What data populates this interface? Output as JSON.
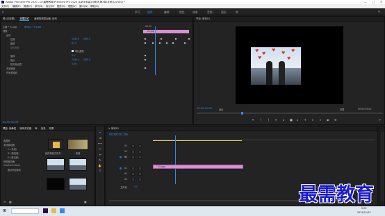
{
  "window": {
    "title": "Adobe Premiere Pro 2020 - D:\\最需教育\\Premiere Pro 2020 从新手到高手\\素材\\第3章\\未命名.prproj *"
  },
  "menu": [
    "文件(F)",
    "编辑(E)",
    "剪辑(C)",
    "序列(S)",
    "标记(M)",
    "图形(G)",
    "视图(V)",
    "窗口(W)",
    "帮助(H)"
  ],
  "workspace_tabs": [
    {
      "label": "学习",
      "active": false
    },
    {
      "label": "组件",
      "active": true
    },
    {
      "label": "编辑",
      "active": false
    },
    {
      "label": "颜色",
      "active": false
    },
    {
      "label": "效果",
      "active": false
    },
    {
      "label": "音频",
      "active": false
    },
    {
      "label": "图形",
      "active": false
    },
    {
      "label": "库",
      "active": false
    }
  ],
  "effect_controls": {
    "tabs": [
      "源:(无剪辑)",
      "效果控件",
      "音频剪辑混合器: 序列"
    ],
    "source_label": "主要 * 01.jpg",
    "clip_label": "序列01 * 01.jpg",
    "sections": [
      "视频",
      "运动",
      "位置",
      "缩放",
      "缩放宽度",
      "等比缩放",
      "旋转",
      "锚点",
      "防闪烁滤镜",
      "不透明度",
      "时间重映射"
    ],
    "position_values": [
      "1440.0",
      "1080.0"
    ],
    "scale_value": "87.0",
    "uniform_scale_label": "等比缩放",
    "rotation_value": "0.0",
    "anchor_values": [
      "1440.0",
      "1080.0"
    ],
    "antiflicker_value": "0.00",
    "clip_name": "01.jpg",
    "ruler": "00:00",
    "timecode": "00:00:01:06"
  },
  "program_monitor": {
    "title": "节目: 序列01",
    "timecode": "00:00:01:06",
    "fit_label": "适合",
    "quality_label": "完整",
    "duration": "00:00:05:00"
  },
  "project_panel": {
    "tabs": [
      "项目: 未命名",
      "媒体浏览器",
      "库",
      "信息",
      "效果"
    ],
    "tree": [
      "收藏夹",
      "本地驱动器",
      "C: (系统)",
      "D: (新加卷)",
      "E: (新加卷)",
      "网络驱动器",
      "Creative Cloud",
      "团队项目版本"
    ],
    "thumbs": [
      {
        "name": "我的电脑文件夹"
      },
      {
        "name": "新建"
      },
      {
        "name": ""
      },
      {
        "name": ""
      },
      {
        "name": ""
      },
      {
        "name": ""
      }
    ]
  },
  "timeline": {
    "title": "序列01",
    "timecode": "00:00:01:06",
    "tracks": [
      "V3",
      "V2",
      "V1",
      "A1",
      "A2",
      "A3"
    ],
    "master_label": "主声道",
    "master_value": "0.0",
    "clip_label": "01.jpg"
  },
  "watermark": "最需教育",
  "taskbar": {
    "time": "9:02",
    "date": "2021/11/22"
  },
  "colors": {
    "accent": "#2d8ceb",
    "clip": "#d98fd3",
    "panel": "#232323"
  }
}
